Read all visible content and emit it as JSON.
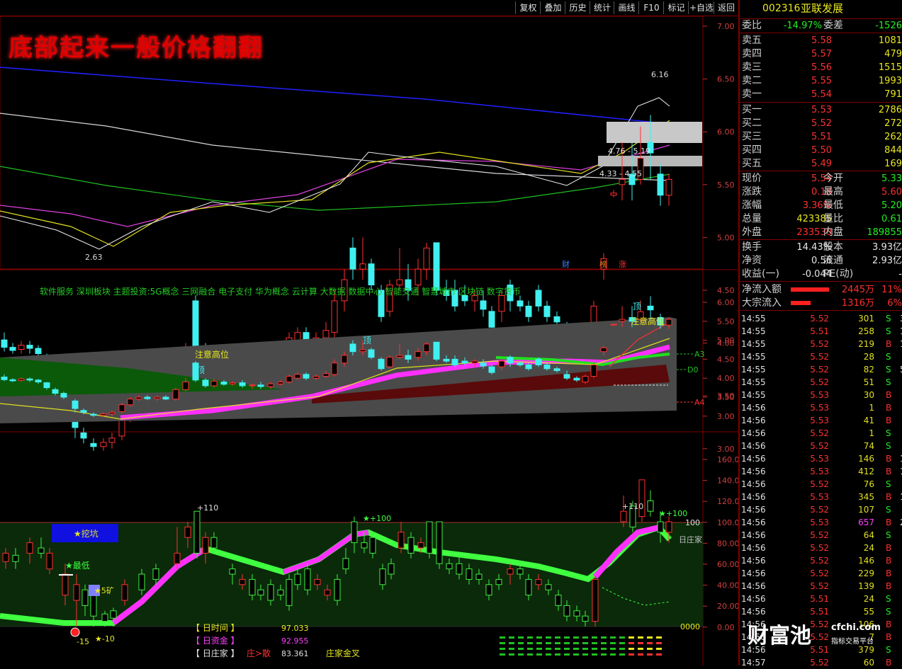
{
  "toolbar": {
    "buttons": [
      "复权",
      "叠加",
      "历史",
      "统计",
      "画线",
      "F10",
      "标记",
      "+自选",
      "返回"
    ]
  },
  "banner": "底部起来一般价格翻翻",
  "main_chart": {
    "y_ticks": [
      "7.00",
      "6.50",
      "6.00",
      "5.50",
      "5.00",
      "4.50",
      "4.00",
      "3.50",
      "3.00"
    ],
    "high_label": "6.16",
    "low_label": "2.63",
    "zone1_label": "4.76 - 5.19",
    "zone2_label": "4.33 - 4.55",
    "markers": [
      "财",
      "榜",
      "涨"
    ]
  },
  "concepts": "软件服务 深圳板块 主题投资:5G概念 三网融合 电子支付 华为概念 云计算 大数据 数据中心 智能交通 智慧城市 区块链 数字货币",
  "second_chart": {
    "y_ticks": [
      "6.00",
      "5.50",
      "5.00",
      "4.50",
      "4.00",
      "3.50",
      "3.00"
    ],
    "label_warn1": "注意高位",
    "label_warn2": "注意高位",
    "label_top1": "顶",
    "label_top2": "顶",
    "label_top3": "顶",
    "line_labels": [
      "A3",
      "D0",
      "A4"
    ]
  },
  "third_chart": {
    "y_ticks": [
      "160.0",
      "140.0",
      "120.0",
      "100.0",
      "80.00",
      "60.00",
      "40.00",
      "20.00",
      "0.00"
    ],
    "label_100": "100",
    "label_rizhuang": "日庄家",
    "label_0000": "0000",
    "dig_button": "★挖坑",
    "low_star": "★最低",
    "mine_label": "★5矿",
    "plus110a": "+110",
    "plus110b": "+110",
    "star100a": "★+100",
    "star100b": "★+100",
    "minus15": "-15",
    "minus10": "★-10",
    "legend": [
      {
        "name": "【 日时间 】",
        "value": "97.033",
        "color": "#e8e820"
      },
      {
        "name": "【 日资金 】",
        "value": "92.955",
        "color": "#ff40ff"
      },
      {
        "name": "【 日庄家 】",
        "value": "83.361",
        "color": "#e0e0e0"
      }
    ],
    "legend_extra1": "庄>散",
    "legend_extra2": "庄家金叉"
  },
  "quote": {
    "code": "002316",
    "name": "亚联发展",
    "wei_bi_label": "委比",
    "wei_bi": "-14.97%",
    "wei_cha_label": "委差",
    "wei_cha": "-1526",
    "sell": [
      {
        "label": "卖五",
        "price": "5.58",
        "vol": "1081"
      },
      {
        "label": "卖四",
        "price": "5.57",
        "vol": "479"
      },
      {
        "label": "卖三",
        "price": "5.56",
        "vol": "1515"
      },
      {
        "label": "卖二",
        "price": "5.55",
        "vol": "1993"
      },
      {
        "label": "卖一",
        "price": "5.54",
        "vol": "791"
      }
    ],
    "buy": [
      {
        "label": "买一",
        "price": "5.53",
        "vol": "2786"
      },
      {
        "label": "买二",
        "price": "5.52",
        "vol": "272"
      },
      {
        "label": "买三",
        "price": "5.51",
        "vol": "262"
      },
      {
        "label": "买四",
        "price": "5.50",
        "vol": "844"
      },
      {
        "label": "买五",
        "price": "5.49",
        "vol": "169"
      }
    ],
    "stats": [
      {
        "k1": "现价",
        "v1": "5.54",
        "c1": "red",
        "k2": "今开",
        "v2": "5.33",
        "c2": "green"
      },
      {
        "k1": "涨跌",
        "v1": "0.18",
        "c1": "red",
        "k2": "最高",
        "v2": "5.60",
        "c2": "red"
      },
      {
        "k1": "涨幅",
        "v1": "3.36%",
        "c1": "red",
        "k2": "最低",
        "v2": "5.20",
        "c2": "green"
      },
      {
        "k1": "总量",
        "v1": "423385",
        "c1": "yellow",
        "k2": "量比",
        "v2": "0.61",
        "c2": "green"
      },
      {
        "k1": "外盘",
        "v1": "233530",
        "c1": "red",
        "k2": "内盘",
        "v2": "189855",
        "c2": "green"
      }
    ],
    "stats2": [
      {
        "k1": "换手",
        "v1": "14.43%",
        "k2": "股本",
        "v2": "3.93亿"
      },
      {
        "k1": "净资",
        "v1": "0.56",
        "k2": "流通",
        "v2": "2.93亿"
      },
      {
        "k1": "收益(一)",
        "v1": "-0.044",
        "k2": "PE(动)",
        "v2": "-"
      }
    ],
    "flows": [
      {
        "k": "净流入额",
        "v": "2445万",
        "p": "11%"
      },
      {
        "k": "大宗流入",
        "v": "1316万",
        "p": "6%"
      }
    ],
    "ticks": [
      {
        "t": "14:55",
        "p": "5.52",
        "v": "301",
        "bs": "S",
        "x": "3"
      },
      {
        "t": "14:55",
        "p": "5.51",
        "v": "258",
        "bs": "S",
        "x": "1"
      },
      {
        "t": "14:55",
        "p": "5.52",
        "v": "219",
        "bs": "B",
        "x": "1"
      },
      {
        "t": "14:55",
        "p": "5.52",
        "v": "28",
        "bs": "S",
        "x": ""
      },
      {
        "t": "14:55",
        "p": "5.52",
        "v": "82",
        "bs": "S",
        "x": "5"
      },
      {
        "t": "14:55",
        "p": "5.52",
        "v": "51",
        "bs": "S",
        "x": ""
      },
      {
        "t": "14:55",
        "p": "5.53",
        "v": "30",
        "bs": "B",
        "x": ""
      },
      {
        "t": "14:56",
        "p": "5.53",
        "v": "1",
        "bs": "B",
        "x": ""
      },
      {
        "t": "14:56",
        "p": "5.53",
        "v": "41",
        "bs": "B",
        "x": ""
      },
      {
        "t": "14:56",
        "p": "5.52",
        "v": "1",
        "bs": "S",
        "x": ""
      },
      {
        "t": "14:56",
        "p": "5.52",
        "v": "74",
        "bs": "S",
        "x": ""
      },
      {
        "t": "14:56",
        "p": "5.53",
        "v": "146",
        "bs": "B",
        "x": "1"
      },
      {
        "t": "14:56",
        "p": "5.53",
        "v": "412",
        "bs": "B",
        "x": "1"
      },
      {
        "t": "14:56",
        "p": "5.52",
        "v": "76",
        "bs": "S",
        "x": ""
      },
      {
        "t": "14:56",
        "p": "5.53",
        "v": "345",
        "bs": "B",
        "x": "1"
      },
      {
        "t": "14:56",
        "p": "5.52",
        "v": "107",
        "bs": "S",
        "x": ""
      },
      {
        "t": "14:56",
        "p": "5.53",
        "v": "657",
        "bs": "B",
        "x": "2",
        "mag": true
      },
      {
        "t": "14:56",
        "p": "5.52",
        "v": "64",
        "bs": "S",
        "x": ""
      },
      {
        "t": "14:56",
        "p": "5.52",
        "v": "24",
        "bs": "B",
        "x": ""
      },
      {
        "t": "14:56",
        "p": "5.52",
        "v": "146",
        "bs": "B",
        "x": ""
      },
      {
        "t": "14:56",
        "p": "5.52",
        "v": "229",
        "bs": "B",
        "x": ""
      },
      {
        "t": "14:56",
        "p": "5.52",
        "v": "139",
        "bs": "B",
        "x": ""
      },
      {
        "t": "14:56",
        "p": "5.51",
        "v": "24",
        "bs": "S",
        "x": ""
      },
      {
        "t": "14:56",
        "p": "5.51",
        "v": "55",
        "bs": "S",
        "x": ""
      },
      {
        "t": "14:56",
        "p": "5.52",
        "v": "106",
        "bs": "B",
        "x": ""
      },
      {
        "t": "14:56",
        "p": "5.52",
        "v": "7",
        "bs": "B",
        "x": ""
      },
      {
        "t": "14:56",
        "p": "5.51",
        "v": "379",
        "bs": "S",
        "x": ""
      },
      {
        "t": "14:57",
        "p": "5.52",
        "v": "60",
        "bs": "B",
        "x": ""
      }
    ]
  },
  "watermark": {
    "logo": "财富池",
    "site": "cfchi.com",
    "sub": "指标交易平台"
  }
}
